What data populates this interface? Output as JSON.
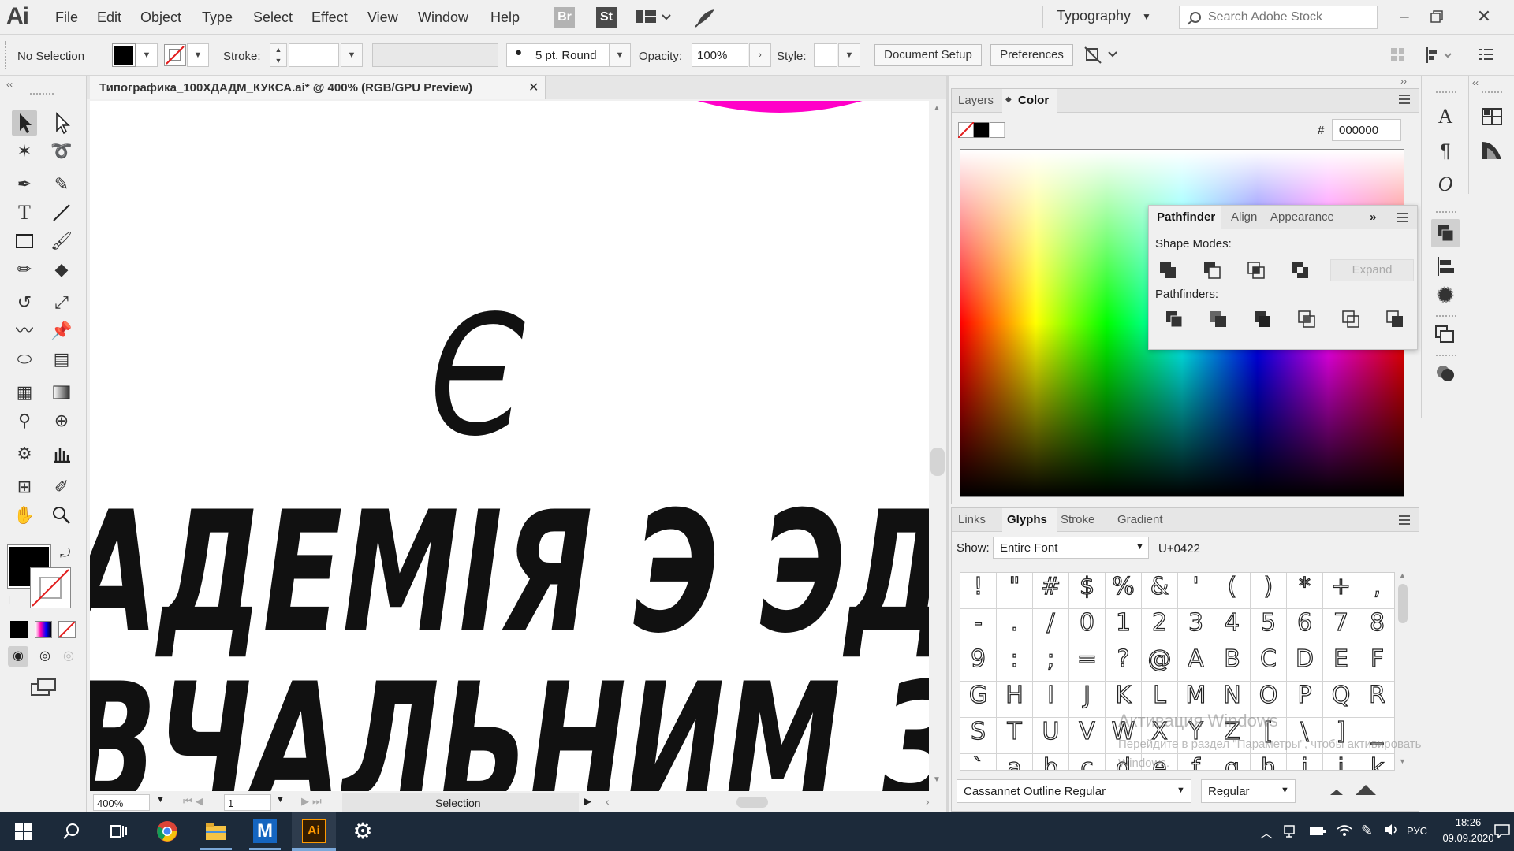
{
  "app": {
    "logo": "Ai",
    "icon_br": "Br",
    "icon_st": "St"
  },
  "menu": [
    "File",
    "Edit",
    "Object",
    "Type",
    "Select",
    "Effect",
    "View",
    "Window",
    "Help"
  ],
  "workspace": "Typography",
  "search": {
    "placeholder": "Search Adobe Stock"
  },
  "control": {
    "selection": "No Selection",
    "stroke_label": "Stroke:",
    "brush": "5 pt. Round",
    "opacity_label": "Opacity:",
    "opacity_value": "100%",
    "style_label": "Style:",
    "document_setup": "Document Setup",
    "preferences": "Preferences"
  },
  "document": {
    "tab_title": "Типографика_100ХДАДМ_КУКСА.ai* @ 400% (RGB/GPU Preview)",
    "artwork": {
      "letter": "Є",
      "line1": "АДЕМІЯ Э ЭДИНИМ",
      "line2": "ВЧАЛЬНИМ ЗАКЛА"
    }
  },
  "status": {
    "zoom": "400%",
    "artboard": "1",
    "tool": "Selection"
  },
  "layers_panel": {
    "tabs": [
      "Layers",
      "Color"
    ],
    "hex_label": "#",
    "hex_value": "000000"
  },
  "pathfinder_panel": {
    "tabs": [
      "Pathfinder",
      "Align",
      "Appearance"
    ],
    "shape_modes": "Shape Modes:",
    "pathfinders": "Pathfinders:",
    "expand": "Expand"
  },
  "glyphs_panel": {
    "tabs": [
      "Links",
      "Glyphs",
      "Stroke",
      "Gradient"
    ],
    "show_label": "Show:",
    "show_value": "Entire Font",
    "unicode": "U+0422",
    "glyphs": [
      "!",
      "\"",
      "#",
      "$",
      "%",
      "&",
      "'",
      "(",
      ")",
      "*",
      "+",
      ",",
      "-",
      ".",
      "/",
      "0",
      "1",
      "2",
      "3",
      "4",
      "5",
      "6",
      "7",
      "8",
      "9",
      ":",
      ";",
      "=",
      "?",
      "@",
      "A",
      "B",
      "C",
      "D",
      "E",
      "F",
      "G",
      "H",
      "I",
      "J",
      "K",
      "L",
      "M",
      "N",
      "O",
      "P",
      "Q",
      "R",
      "S",
      "T",
      "U",
      "V",
      "W",
      "X",
      "Y",
      "Z",
      "[",
      "\\",
      "]",
      "_",
      "`",
      "a",
      "b",
      "c",
      "d",
      "e",
      "f",
      "g",
      "h",
      "i",
      "j",
      "k"
    ],
    "font_name": "Cassannet Outline Regular",
    "font_style": "Regular"
  },
  "watermark": {
    "line1": "Активация Windows",
    "line2": "Перейдите в раздел \"Параметры\", чтобы активировать",
    "line3": "Windows."
  },
  "taskbar": {
    "lang": "РУС",
    "time": "18:26",
    "date": "09.09.2020"
  },
  "colors": {
    "magenta": "#ff00c8",
    "taskbar": "#1c2a3a",
    "accent": "#2b6cc4"
  }
}
